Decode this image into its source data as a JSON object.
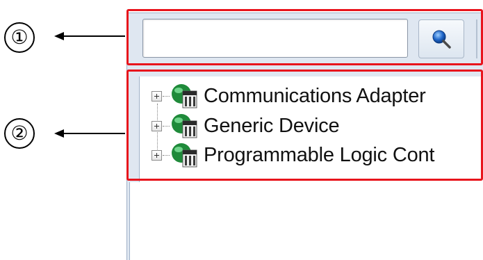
{
  "callouts": [
    {
      "number": "①",
      "target": "search-bar"
    },
    {
      "number": "②",
      "target": "device-tree"
    }
  ],
  "search": {
    "value": "",
    "button_icon": "search-icon"
  },
  "tree": {
    "items": [
      {
        "label": "Communications Adapter",
        "expander": "plus-expander-icon",
        "icon": "device-icon"
      },
      {
        "label": "Generic Device",
        "expander": "plus-expander-icon",
        "icon": "device-icon"
      },
      {
        "label": "Programmable Logic Cont",
        "expander": "plus-expander-icon",
        "icon": "device-icon"
      }
    ]
  },
  "colors": {
    "highlight": "#e8141c",
    "panel_background": "#dfe7f1",
    "device_icon_green": "#1f8a3a"
  }
}
